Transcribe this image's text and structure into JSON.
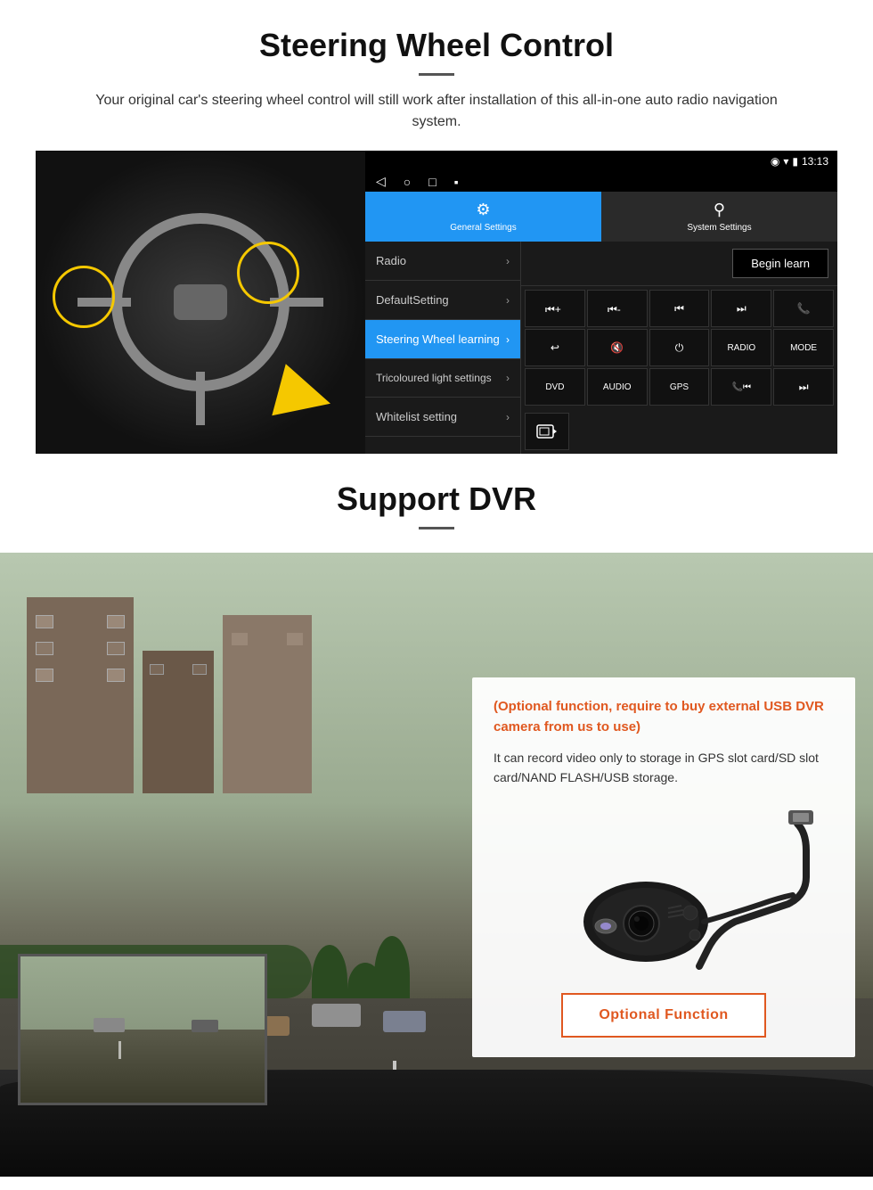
{
  "steering_section": {
    "title": "Steering Wheel Control",
    "subtitle": "Your original car's steering wheel control will still work after installation of this all-in-one auto radio navigation system.",
    "statusbar": {
      "time": "13:13",
      "signal_icon": "▼",
      "wifi_icon": "▾",
      "battery_icon": "▮"
    },
    "tabs": [
      {
        "id": "general",
        "label": "General Settings",
        "active": true
      },
      {
        "id": "system",
        "label": "System Settings",
        "active": false
      }
    ],
    "menu_items": [
      {
        "label": "Radio",
        "active": false
      },
      {
        "label": "DefaultSetting",
        "active": false
      },
      {
        "label": "Steering Wheel learning",
        "active": true
      },
      {
        "label": "Tricoloured light settings",
        "active": false
      },
      {
        "label": "Whitelist setting",
        "active": false
      }
    ],
    "begin_learn_btn": "Begin learn",
    "control_buttons": [
      "⏮+",
      "⏮-",
      "⏮⏮",
      "⏭⏭",
      "📞",
      "↩",
      "🔇x",
      "⏻",
      "RADIO",
      "MODE",
      "DVD",
      "AUDIO",
      "GPS",
      "📞⏮",
      "⏭⏭"
    ],
    "dvr_icon": "📷"
  },
  "dvr_section": {
    "title": "Support DVR",
    "optional_text": "(Optional function, require to buy external USB DVR camera from us to use)",
    "description": "It can record video only to storage in GPS slot card/SD slot card/NAND FLASH/USB storage.",
    "optional_fn_btn": "Optional Function"
  }
}
